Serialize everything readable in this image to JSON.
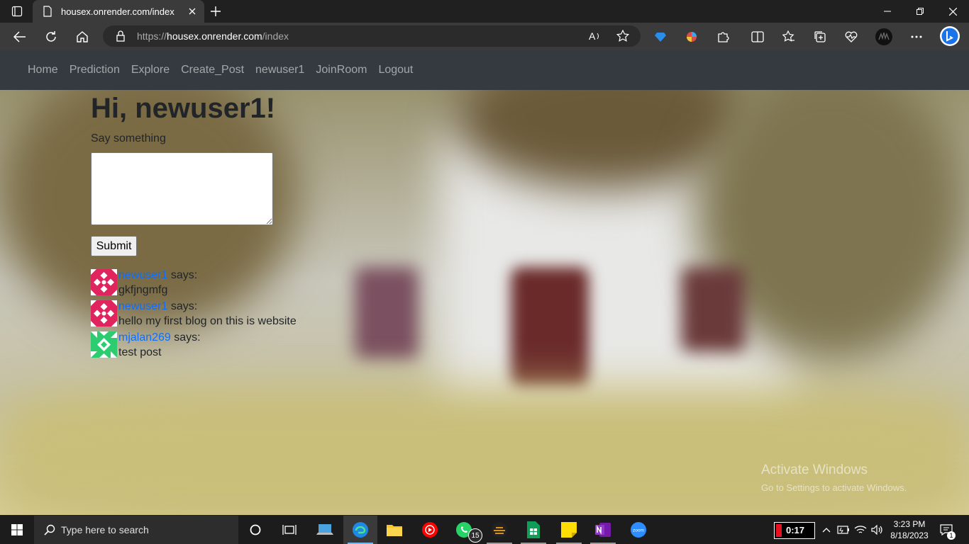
{
  "browser": {
    "tab_title": "housex.onrender.com/index",
    "url_scheme": "https://",
    "url_host": "housex.onrender.com",
    "url_path": "/index"
  },
  "site_nav": {
    "links": [
      "Home",
      "Prediction",
      "Explore",
      "Create_Post",
      "newuser1",
      "JoinRoom",
      "Logout"
    ]
  },
  "main": {
    "greeting": "Hi, newuser1!",
    "say_label": "Say something",
    "textarea_value": "",
    "submit_label": "Submit"
  },
  "posts": [
    {
      "author": "newuser1",
      "says": "says:",
      "body": "gkfjngmfg",
      "avatar_color": "#e0245e"
    },
    {
      "author": "newuser1",
      "says": "says:",
      "body": "hello my first blog on this is website",
      "avatar_color": "#e0245e"
    },
    {
      "author": "mjalan269",
      "says": "says:",
      "body": "test post",
      "avatar_color": "#2ecc71"
    }
  ],
  "watermark": {
    "line1": "Activate Windows",
    "line2": "Go to Settings to activate Windows."
  },
  "taskbar": {
    "search_placeholder": "Type here to search",
    "whatsapp_badge": "15",
    "timer": "0:17",
    "time": "3:23 PM",
    "date": "8/18/2023",
    "notification_count": "1"
  },
  "colors": {
    "nav_bg": "#343a40",
    "link": "#0d6efd",
    "chrome_bg": "#202020",
    "toolbar_bg": "#3b3b3b"
  }
}
